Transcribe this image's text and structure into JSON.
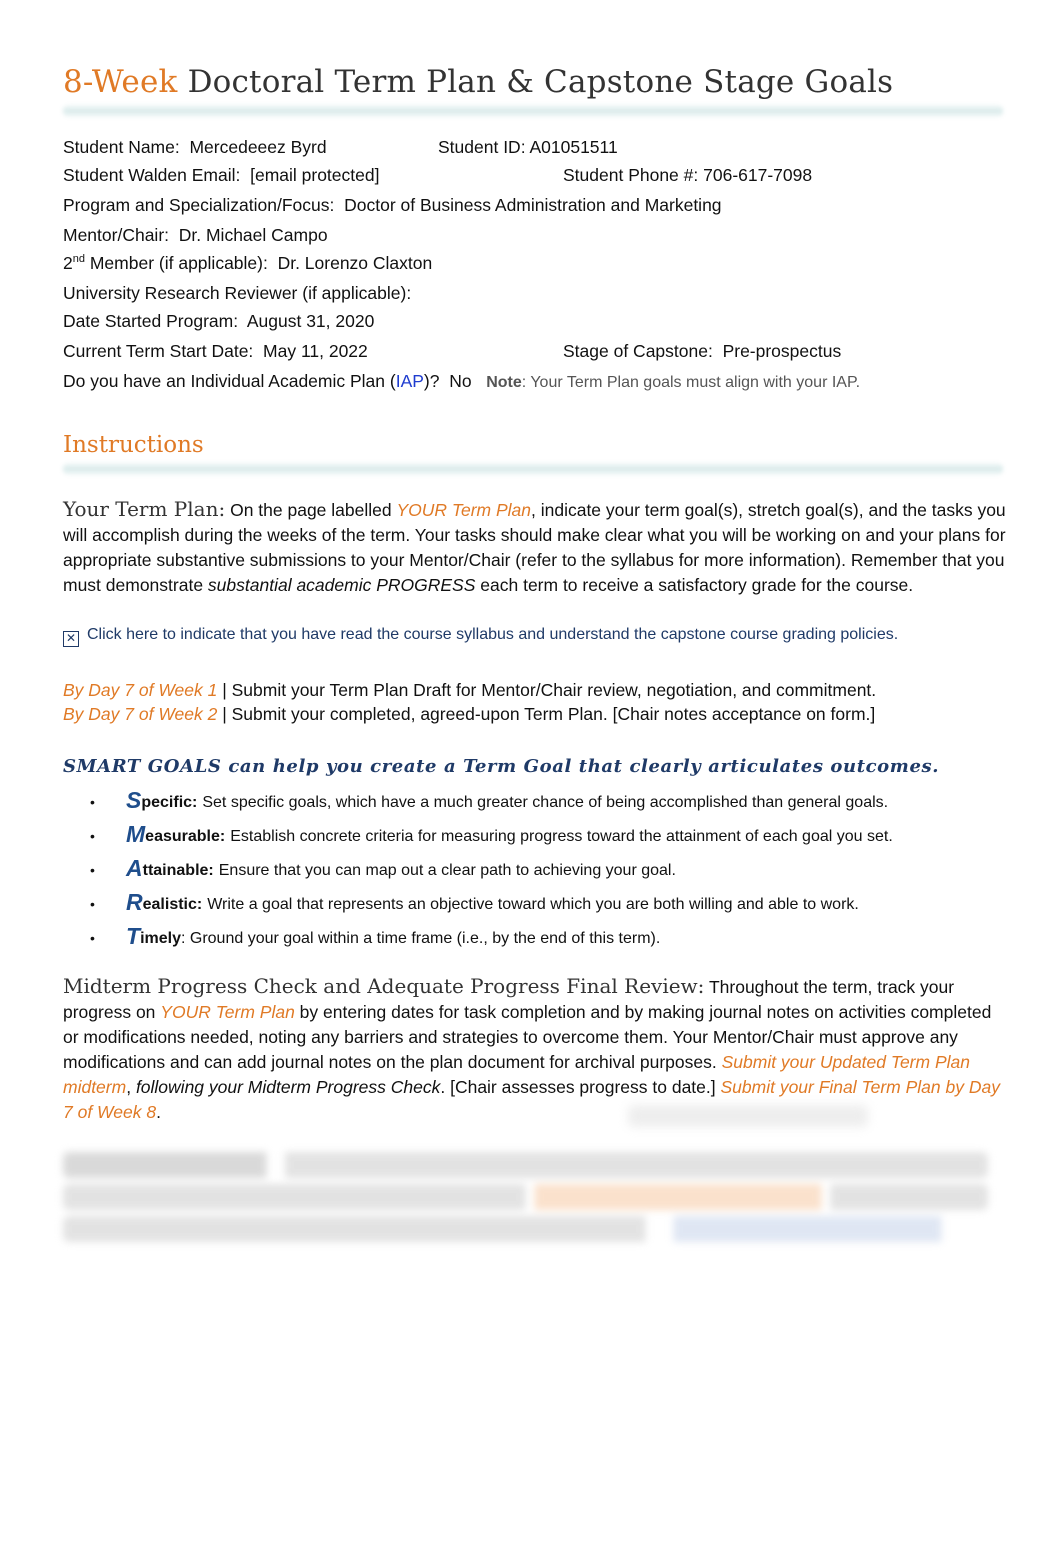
{
  "header": {
    "title_accent": "8-Week",
    "title_rest": "Doctoral Term Plan & Capstone Stage Goals"
  },
  "student_info": {
    "name_label": "Student Name:",
    "name_value": "Mercedeeez Byrd",
    "id_label": "Student ID:",
    "id_value": "A01051511",
    "email_label": "Student Walden Email:",
    "email_value": "[email protected]",
    "phone_label": "Student Phone #:",
    "phone_value": "706-617-7098",
    "program_label": "Program and Specialization/Focus:",
    "program_value": "Doctor of Business Administration and Marketing",
    "mentor_label": "Mentor/Chair:",
    "mentor_value": "Dr. Michael Campo",
    "second_member_prefix": "2",
    "second_member_sup": "nd",
    "second_member_label": "Member (if applicable):",
    "second_member_value": "Dr. Lorenzo Claxton",
    "urr_label": "University Research Reviewer (if applicable):",
    "urr_value": "",
    "date_started_label": "Date Started Program:",
    "date_started_value": "August 31, 2020",
    "term_start_label": "Current Term Start Date:",
    "term_start_value": "May 11, 2022",
    "stage_label": "Stage of Capstone:",
    "stage_value": "Pre-prospectus",
    "iap_question_pre": "Do you have an Individual Academic Plan (",
    "iap_link": "IAP",
    "iap_question_post": ")?",
    "iap_value": "No",
    "note_label": "Note",
    "note_text": ": Your Term Plan goals must align with your IAP."
  },
  "instructions": {
    "heading": "Instructions",
    "term_plan_lead": "Your Term Plan:",
    "term_plan_p1": " On the page labelled ",
    "term_plan_link": "YOUR Term Plan",
    "term_plan_p2": ", indicate your term goal(s), stretch goal(s), and the tasks you will accomplish during the weeks of the term. Your tasks should make clear what you will be working on and your plans for appropriate substantive submissions to your Mentor/Chair (refer to the syllabus for more information). Remember that you must demonstrate ",
    "term_plan_emph": "substantial academic PROGRESS",
    "term_plan_p3": " each term to receive a satisfactory grade for the course.",
    "checkbox_glyph": "☒",
    "checkbox_checked": true,
    "checkbox_label": "Click here to indicate that you have read the course syllabus and understand the capstone course grading policies.",
    "deadlines": [
      {
        "when": "By Day 7 of Week 1",
        "sep": " | ",
        "what": "Submit your Term Plan Draft for Mentor/Chair review, negotiation, and commitment."
      },
      {
        "when": "By Day 7 of Week 2",
        "sep": " | ",
        "what": "Submit your completed, agreed-upon Term Plan. [Chair notes acceptance on form.]"
      }
    ],
    "smart_heading": "SMART GOALS can help you create a Term Goal that clearly articulates outcomes.",
    "smart_items": [
      {
        "letter": "S",
        "rest": "pecific:",
        "desc": "Set specific goals, which have a much greater chance of being accomplished than general goals."
      },
      {
        "letter": "M",
        "rest": "easurable:",
        "desc": "Establish concrete criteria for measuring progress toward the attainment of each goal you set."
      },
      {
        "letter": "A",
        "rest": "ttainable:",
        "desc": "Ensure that you can map out a clear path to achieving your goal."
      },
      {
        "letter": "R",
        "rest": "ealistic:",
        "desc": "Write a goal that represents an objective toward which you are both willing and able to work."
      },
      {
        "letter": "T",
        "rest": "imely",
        "desc": ": Ground your goal within a time frame (i.e., by the end of this term)."
      }
    ],
    "midterm_lead": "Midterm Progress Check and Adequate Progress Final Review:",
    "midterm_p1": " Throughout the term, track your progress on ",
    "midterm_link": "YOUR Term Plan",
    "midterm_p2": " by entering dates for task completion and by making journal notes on activities completed or modifications needed, noting any barriers and strategies to overcome them. Your Mentor/Chair must approve any modifications and can add journal notes on the plan document for archival purposes. ",
    "midterm_submit_updated": "Submit your Updated Term Plan midterm",
    "midterm_p3": ", ",
    "midterm_emph": "following your Midterm Progress Check",
    "midterm_p4": ". [Chair assesses progress to date.] ",
    "midterm_submit_final": "Submit your Final Term Plan by Day 7 of Week 8",
    "midterm_p5": "."
  },
  "colors": {
    "accent_orange": "#e07a26",
    "navy": "#1f3a67",
    "smart_letter_blue": "#1f4e8c",
    "link_blue": "#1f3ccf"
  }
}
